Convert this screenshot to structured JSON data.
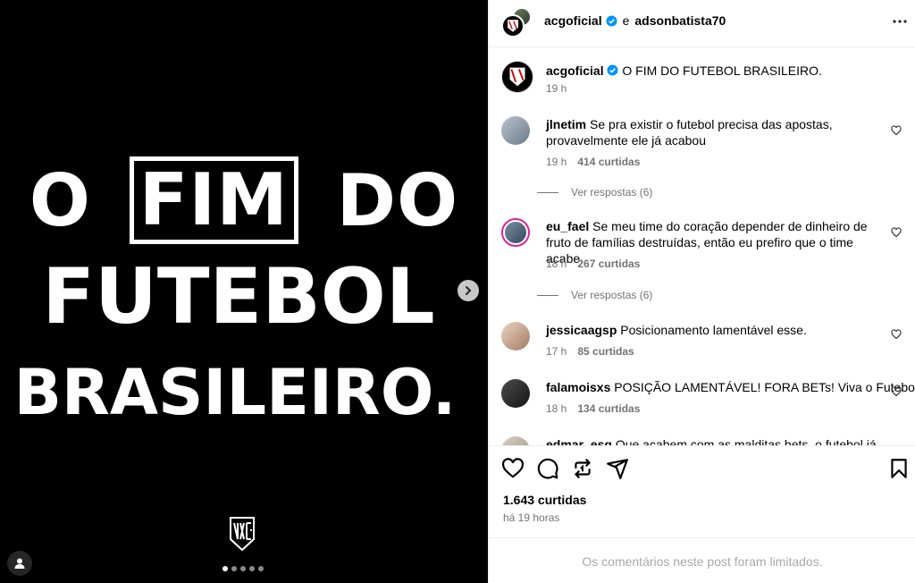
{
  "post_image": {
    "headline_line1": [
      "O",
      "FIM",
      "DO"
    ],
    "headline_line2": "FUTEBOL",
    "headline_line3": "BRASILEIRO.",
    "carousel_dots": 5,
    "carousel_active_index": 0,
    "next_icon": "chevron-right-icon",
    "user_tags_icon": "person-icon"
  },
  "header": {
    "author": "acgoficial",
    "connector": "e",
    "collaborator": "adsonbatista70",
    "more_icon": "more-horizontal-icon"
  },
  "caption": {
    "username": "acgoficial",
    "text": "O FIM DO FUTEBOL BRASILEIRO.",
    "time": "19 h"
  },
  "comments": [
    {
      "username": "jlnetim",
      "text": "Se pra existir o futebol precisa das apostas, provavelmente ele já acabou",
      "time": "19 h",
      "likes": "414 curtidas",
      "replies": "Ver respostas (6)"
    },
    {
      "username": "eu_fael",
      "text": "Se meu time do coração depender de dinheiro de fruto de famílias destruídas, então eu prefiro que o time acabe.",
      "time": "18 h",
      "likes": "267 curtidas",
      "replies": "Ver respostas (6)"
    },
    {
      "username": "jessicaagsp",
      "text": "Posicionamento lamentável esse.",
      "time": "17 h",
      "likes": "85 curtidas"
    },
    {
      "username": "falamoisxs",
      "text": "POSIÇÃO LAMENTÁVEL! FORA BETs! Viva o Futebol!",
      "time": "18 h",
      "likes": "134 curtidas"
    },
    {
      "username": "edmar_esg",
      "text": "Que acabem com as malditas bets, o futebol já"
    }
  ],
  "actions": {
    "like_icon": "heart-icon",
    "comment_icon": "comment-icon",
    "repost_icon": "repost-icon",
    "share_icon": "send-icon",
    "save_icon": "bookmark-icon",
    "likes": "1.643 curtidas",
    "time_ago": "há 19 horas"
  },
  "footer": {
    "limited_text": "Os comentários neste post foram limitados."
  },
  "colors": {
    "text_secondary": "#737373",
    "verified": "#0095f6",
    "story_ring": "#d6249f"
  }
}
